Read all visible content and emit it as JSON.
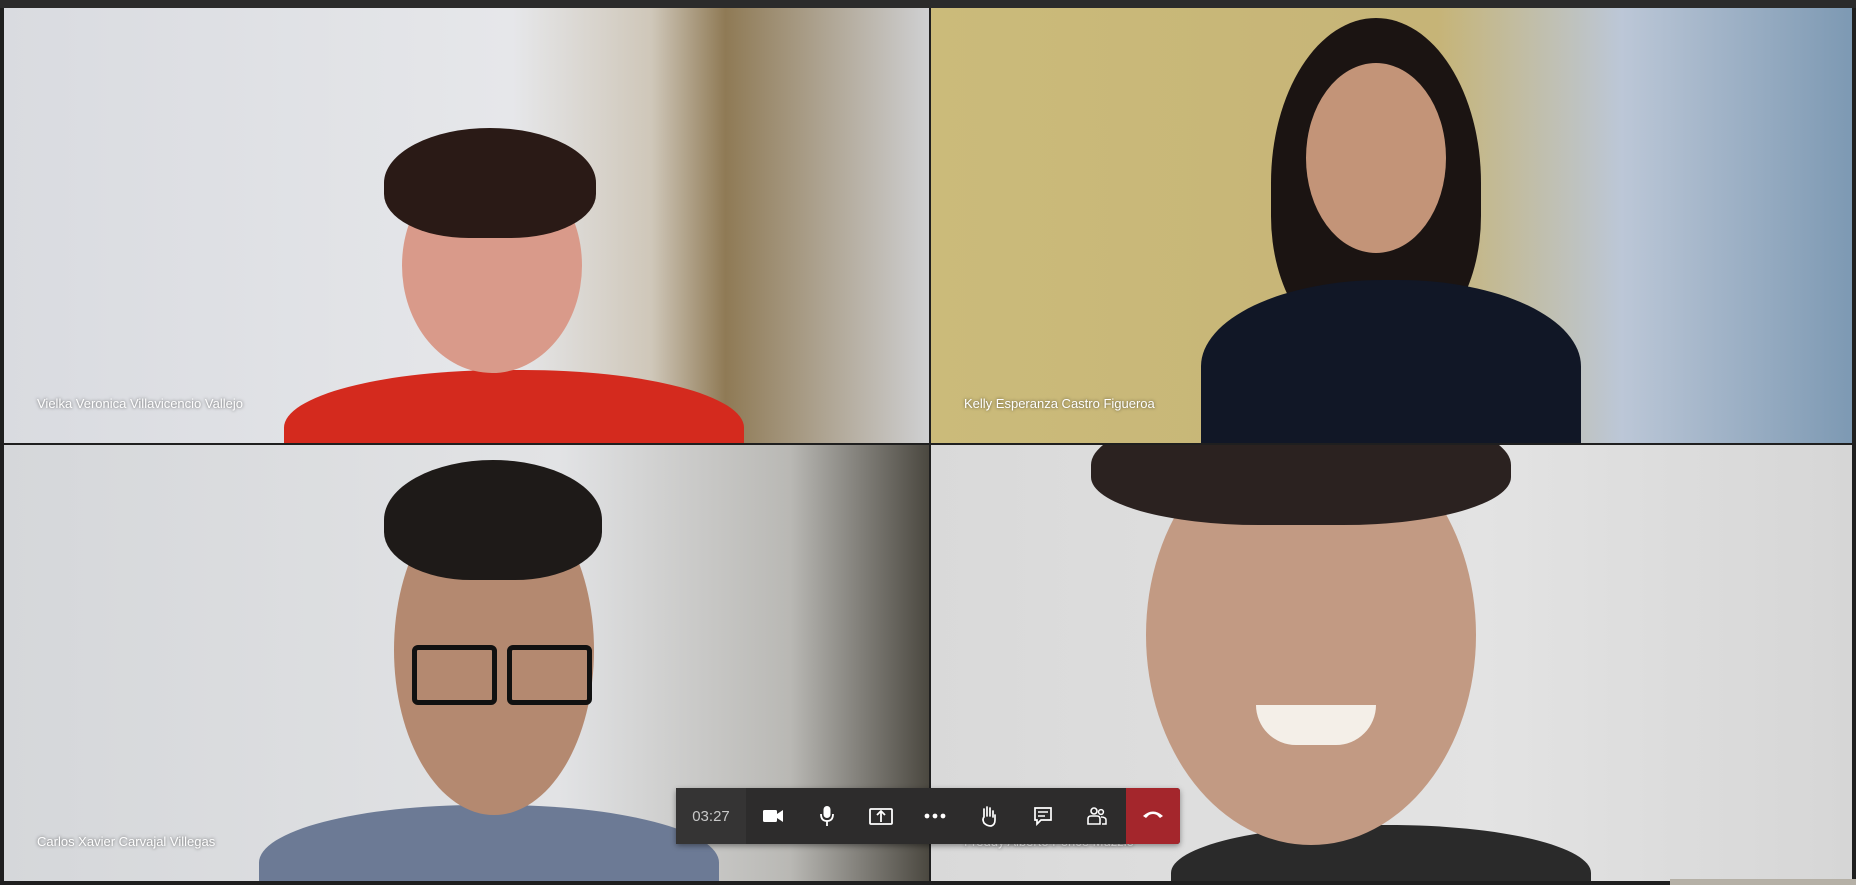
{
  "participants": [
    {
      "name": "Vielka Veronica Villavicencio Vallejo"
    },
    {
      "name": "Kelly Esperanza Castro Figueroa"
    },
    {
      "name": "Carlos Xavier Carvajal Villegas"
    },
    {
      "name": "Freddy Alberto Ponce Muzzio"
    }
  ],
  "toolbar": {
    "timer": "03:27",
    "buttons": [
      {
        "icon": "video-camera-icon"
      },
      {
        "icon": "microphone-icon"
      },
      {
        "icon": "share-screen-icon"
      },
      {
        "icon": "more-options-icon"
      },
      {
        "icon": "raise-hand-icon"
      },
      {
        "icon": "chat-icon"
      },
      {
        "icon": "participants-icon"
      },
      {
        "icon": "hang-up-icon"
      }
    ]
  },
  "colors": {
    "toolbar_bg": "#2d2c2c",
    "hangup": "#a4262c",
    "icon": "#ffffff"
  }
}
